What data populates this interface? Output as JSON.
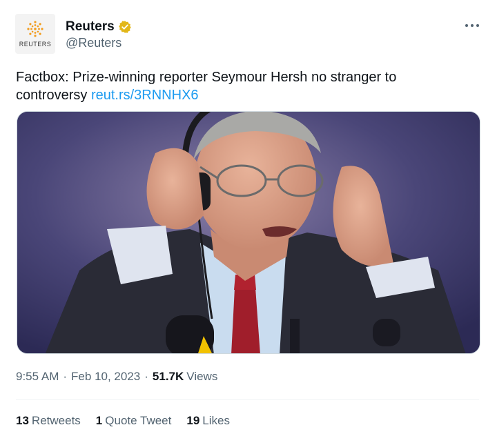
{
  "author": {
    "avatar_text": "REUTERS",
    "display_name": "Reuters",
    "handle": "@Reuters",
    "verified_color": "#e2b719"
  },
  "more_icon": "more-horizontal-icon",
  "tweet": {
    "text": "Factbox: Prize-winning reporter Seymour Hersh no stranger to controversy",
    "link": "reut.rs/3RNNHX6"
  },
  "meta": {
    "time": "9:55 AM",
    "date": "Feb 10, 2023",
    "views_count": "51.7K",
    "views_label": "Views"
  },
  "stats": {
    "retweets_count": "13",
    "retweets_label": "Retweets",
    "quotes_count": "1",
    "quotes_label": "Quote Tweet",
    "likes_count": "19",
    "likes_label": "Likes"
  },
  "colors": {
    "link": "#1d9bf0",
    "secondary_text": "#536471",
    "reuters_orange": "#f29d1f"
  }
}
